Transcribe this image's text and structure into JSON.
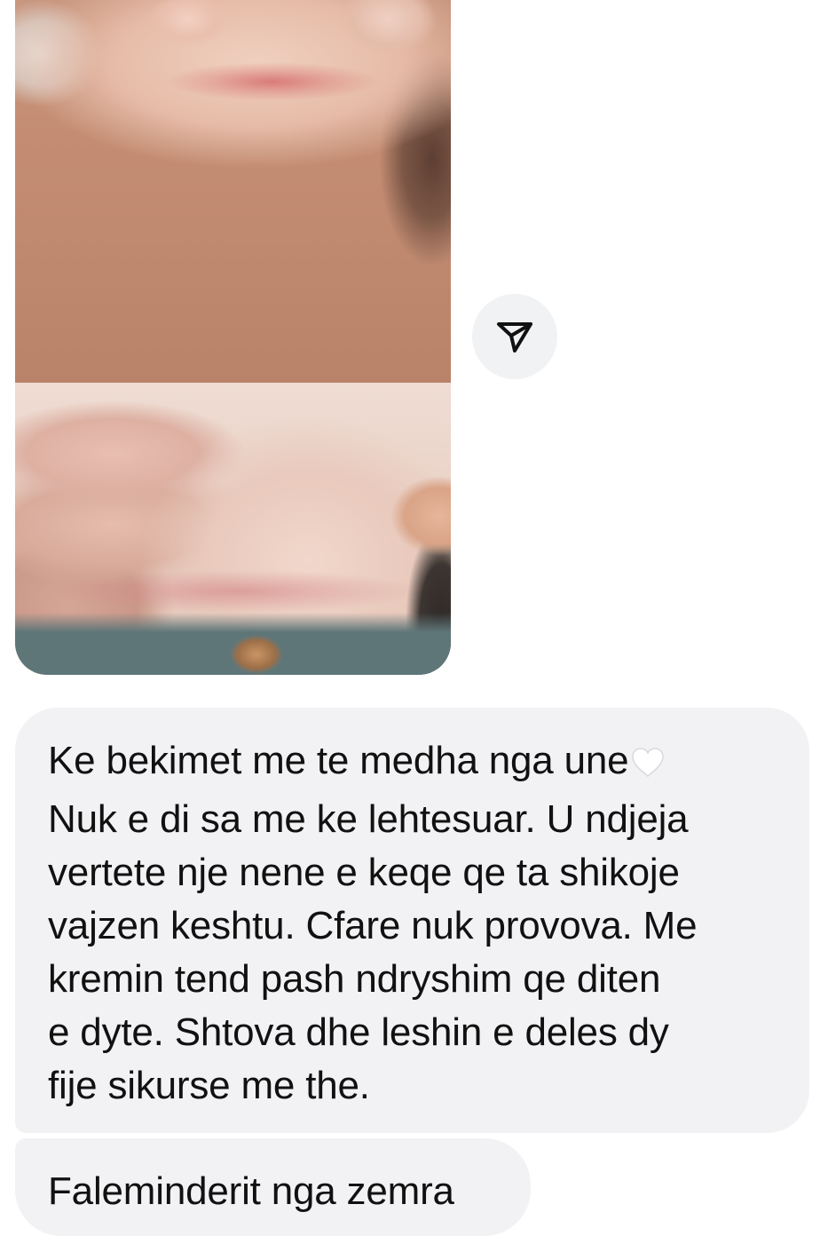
{
  "conversation": {
    "shared_photos": [
      {
        "description_icon": "photo"
      },
      {
        "description_icon": "photo"
      }
    ],
    "forward_action": {
      "icon": "paper-plane-icon"
    },
    "messages": [
      {
        "lines": [
          "Ke bekimet me te medha nga une",
          "Nuk e di sa me ke lehtesuar. U ndjeja",
          "vertete nje nene e keqe qe ta shikoje",
          "vajzen keshtu. Cfare nuk provova. Me",
          "kremin tend pash ndryshim qe diten",
          "e dyte. Shtova dhe leshin e deles dy",
          "fije sikurse me the."
        ],
        "emoji": "🤍"
      },
      {
        "lines": [
          "Faleminderit nga zemra"
        ]
      }
    ]
  },
  "colors": {
    "bubble_background": "#f2f2f4",
    "text": "#111111",
    "forward_button_background": "#f1f2f4"
  }
}
